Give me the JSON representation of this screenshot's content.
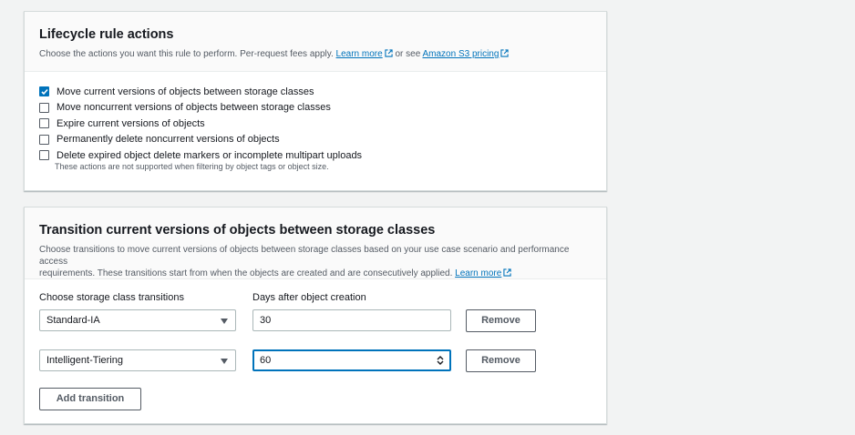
{
  "lifecycle": {
    "title": "Lifecycle rule actions",
    "desc_prefix": "Choose the actions you want this rule to perform. Per-request fees apply.",
    "learn_more": "Learn more",
    "or_see": "or see",
    "pricing_link": "Amazon S3 pricing",
    "options": [
      {
        "label": "Move current versions of objects between storage classes",
        "checked": true
      },
      {
        "label": "Move noncurrent versions of objects between storage classes",
        "checked": false
      },
      {
        "label": "Expire current versions of objects",
        "checked": false
      },
      {
        "label": "Permanently delete noncurrent versions of objects",
        "checked": false
      },
      {
        "label": "Delete expired object delete markers or incomplete multipart uploads",
        "checked": false
      }
    ],
    "note": "These actions are not supported when filtering by object tags or object size."
  },
  "transitions": {
    "title": "Transition current versions of objects between storage classes",
    "desc_line1": "Choose transitions to move current versions of objects between storage classes based on your use case scenario and performance access",
    "desc_line2": "requirements. These transitions start from when the objects are created and are consecutively applied.",
    "learn_more": "Learn more",
    "class_label": "Choose storage class transitions",
    "days_label": "Days after object creation",
    "rows": [
      {
        "storage_class": "Standard-IA",
        "days": "30",
        "remove_label": "Remove"
      },
      {
        "storage_class": "Intelligent-Tiering",
        "days": "60",
        "remove_label": "Remove"
      }
    ],
    "add_label": "Add transition"
  },
  "colors": {
    "link": "#0073bb",
    "checkbox_checked": "#0073bb",
    "focus_border": "#0073bb"
  }
}
